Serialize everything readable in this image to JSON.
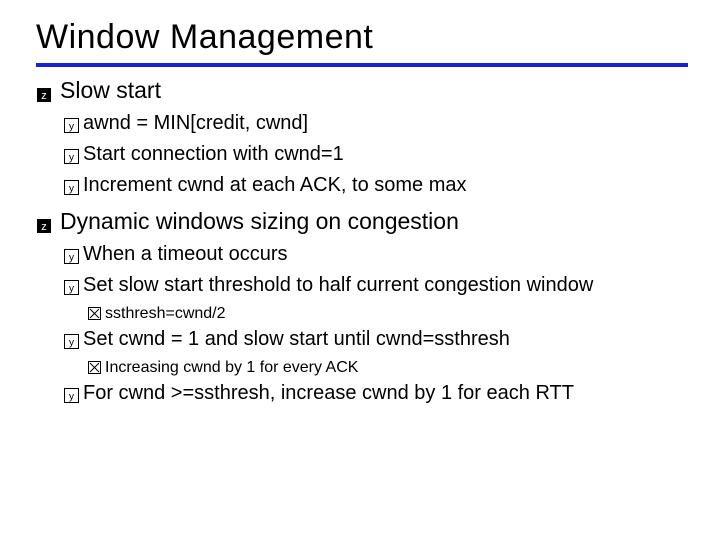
{
  "title": "Window Management",
  "sections": [
    {
      "heading": "Slow start",
      "items": [
        {
          "text": "awnd = MIN[credit, cwnd]"
        },
        {
          "text": "Start connection with cwnd=1"
        },
        {
          "text": "Increment cwnd at each ACK, to some max"
        }
      ]
    },
    {
      "heading": "Dynamic windows sizing on congestion",
      "items": [
        {
          "text": "When a timeout occurs"
        },
        {
          "text": "Set slow start threshold to half current congestion window",
          "sub": [
            {
              "text": "ssthresh=cwnd/2"
            }
          ]
        },
        {
          "text": "Set cwnd = 1 and slow start until cwnd=ssthresh",
          "sub": [
            {
              "text": "Increasing cwnd by 1 for every ACK"
            }
          ]
        },
        {
          "text": "For cwnd >=ssthresh, increase cwnd by 1 for each RTT"
        }
      ]
    }
  ]
}
